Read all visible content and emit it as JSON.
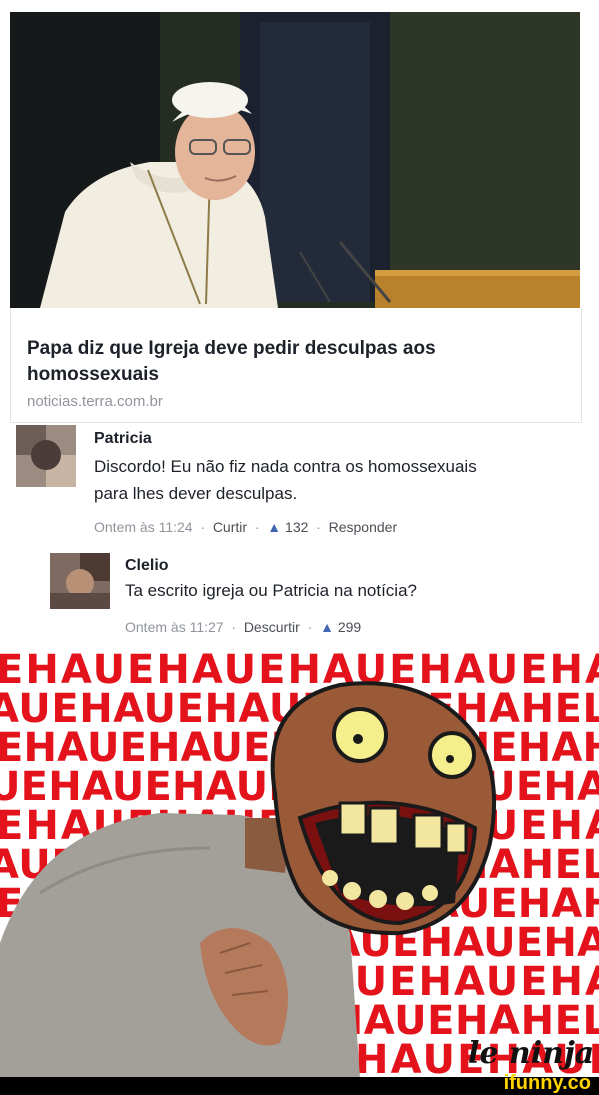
{
  "post": {
    "headline": "Papa diz que Igreja deve pedir desculpas aos homossexuais",
    "domain": "noticias.terra.com.br"
  },
  "comments": [
    {
      "author": "Patricia",
      "text": "Discordo! Eu não fiz nada contra os homossexuais para lhes dever desculpas.",
      "time": "Ontem às 11:24",
      "action": "Curtir",
      "likes": "132",
      "reply": "Responder"
    },
    {
      "author": "Clelio",
      "text": "Ta escrito igreja ou Patricia na notícia?",
      "time": "Ontem às 11:27",
      "action": "Descurtir",
      "likes": "299"
    }
  ],
  "meme": {
    "laugh_rows": [
      "EHAUEHAUEHAUEHAUEHA",
      "AUEHAUEHAUEHAUEHAHEL",
      "EHAUEHAUEHAUEHAUEHAH",
      "UEHAUEHAUEHAUEHAUEHA",
      "EHAUEHAUEHAUEHAUEHA",
      "AUEHAUEHAUEHAUEHAHEL",
      "EHAUEHAUEHAUEHAUEHAH",
      "UEHAUEHAUEHAUEHAUEHA",
      "EHAUEHAUEHAUEHAUEHA",
      "AUEHAUEHAUEHAUEHAHEL",
      "AUEHAUEHAUEHAUEHAUE"
    ],
    "signature": "le ninja",
    "watermark": "ifunny.co"
  },
  "colors": {
    "laugh_text": "#e3121b",
    "link_blue": "#4267b2",
    "meta_gray": "#90949c"
  }
}
